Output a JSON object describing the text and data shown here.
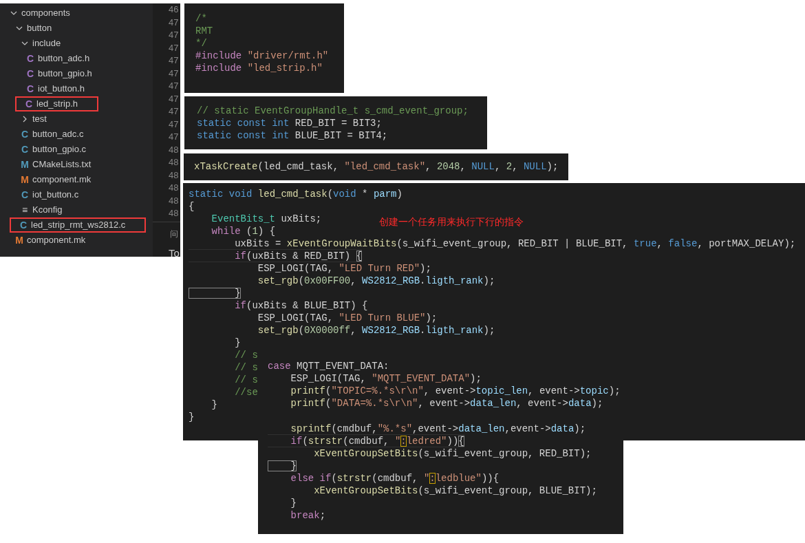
{
  "explorer": {
    "tree": [
      {
        "kind": "folder",
        "name": "components",
        "expanded": true,
        "children": [
          {
            "kind": "folder",
            "name": "button",
            "expanded": true,
            "children": [
              {
                "kind": "folder",
                "name": "include",
                "expanded": true,
                "children": [
                  {
                    "kind": "file",
                    "name": "button_adc.h",
                    "icon": "C",
                    "color": "#a074c4",
                    "highlighted": false
                  },
                  {
                    "kind": "file",
                    "name": "button_gpio.h",
                    "icon": "C",
                    "color": "#a074c4",
                    "highlighted": false
                  },
                  {
                    "kind": "file",
                    "name": "iot_button.h",
                    "icon": "C",
                    "color": "#a074c4",
                    "highlighted": false
                  },
                  {
                    "kind": "file",
                    "name": "led_strip.h",
                    "icon": "C",
                    "color": "#a074c4",
                    "highlighted": true
                  }
                ]
              },
              {
                "kind": "folder",
                "name": "test",
                "expanded": false
              },
              {
                "kind": "file",
                "name": "button_adc.c",
                "icon": "C",
                "color": "#519aba",
                "highlighted": false
              },
              {
                "kind": "file",
                "name": "button_gpio.c",
                "icon": "C",
                "color": "#519aba",
                "highlighted": false
              },
              {
                "kind": "file",
                "name": "CMakeLists.txt",
                "icon": "M",
                "color": "#519aba",
                "highlighted": false
              },
              {
                "kind": "file",
                "name": "component.mk",
                "icon": "M",
                "color": "#e37933",
                "highlighted": false
              },
              {
                "kind": "file",
                "name": "iot_button.c",
                "icon": "C",
                "color": "#519aba",
                "highlighted": false
              },
              {
                "kind": "file",
                "name": "Kconfig",
                "icon": "≡",
                "color": "#cccccc",
                "highlighted": false
              },
              {
                "kind": "file",
                "name": "led_strip_rmt_ws2812.c",
                "icon": "C",
                "color": "#519aba",
                "highlighted": true
              }
            ]
          },
          {
            "kind": "file",
            "name": "component.mk",
            "icon": "M",
            "color": "#e37933",
            "highlighted": false
          }
        ]
      }
    ],
    "line_numbers": [
      "46",
      "47",
      "47",
      "47",
      "47",
      "47",
      "47",
      "47",
      "47",
      "47",
      "47",
      "48",
      "48",
      "48",
      "48",
      "48",
      "48"
    ],
    "panel_tab": "问",
    "panel_text": "To"
  },
  "snippets": [
    {
      "lines": [
        {
          "tokens": [
            {
              "text": "/*",
              "kind": "comment"
            }
          ]
        },
        {
          "tokens": [
            {
              "text": "RMT",
              "kind": "comment"
            }
          ]
        },
        {
          "tokens": [
            {
              "text": "*/",
              "kind": "comment"
            }
          ]
        },
        {
          "tokens": [
            {
              "text": "#include ",
              "kind": "directive"
            },
            {
              "text": "\"driver/rmt.h\"",
              "kind": "string"
            }
          ]
        },
        {
          "tokens": [
            {
              "text": "#include ",
              "kind": "directive"
            },
            {
              "text": "\"led_strip.h\"",
              "kind": "string"
            }
          ]
        }
      ]
    },
    {
      "lines": [
        {
          "tokens": [
            {
              "text": "// static EventGroupHandle_t s_cmd_event_group;",
              "kind": "comment"
            }
          ]
        },
        {
          "tokens": [
            {
              "text": "static const int ",
              "kind": "type"
            },
            {
              "text": "RED_BIT = BIT3;",
              "kind": "plain"
            }
          ]
        },
        {
          "tokens": [
            {
              "text": "static const int ",
              "kind": "type"
            },
            {
              "text": "BLUE_BIT = BIT4;",
              "kind": "plain"
            }
          ]
        }
      ]
    },
    {
      "lines": [
        {
          "tokens": [
            {
              "text": "xTaskCreate",
              "kind": "function"
            },
            {
              "text": "(led_cmd_task, ",
              "kind": "plain"
            },
            {
              "text": "\"led_cmd_task\"",
              "kind": "string"
            },
            {
              "text": ", ",
              "kind": "plain"
            },
            {
              "text": "2048",
              "kind": "number"
            },
            {
              "text": ", ",
              "kind": "plain"
            },
            {
              "text": "NULL",
              "kind": "type"
            },
            {
              "text": ", ",
              "kind": "plain"
            },
            {
              "text": "2",
              "kind": "number"
            },
            {
              "text": ", ",
              "kind": "plain"
            },
            {
              "text": "NULL",
              "kind": "type"
            },
            {
              "text": ");",
              "kind": "plain"
            }
          ]
        }
      ]
    },
    {
      "lines": [
        {
          "tokens": [
            {
              "text": "static void ",
              "kind": "type"
            },
            {
              "text": "led_cmd_task",
              "kind": "function"
            },
            {
              "text": "(",
              "kind": "plain"
            },
            {
              "text": "void",
              "kind": "type"
            },
            {
              "text": " * ",
              "kind": "plain"
            },
            {
              "text": "parm",
              "kind": "variable"
            },
            {
              "text": ")",
              "kind": "plain"
            }
          ]
        },
        {
          "tokens": [
            {
              "text": "{",
              "kind": "plain"
            }
          ]
        },
        {
          "tokens": [
            {
              "text": "    EventBits_t",
              "kind": "typename"
            },
            {
              "text": " uxBits;",
              "kind": "plain"
            }
          ]
        },
        {
          "tokens": [
            {
              "text": "    while",
              "kind": "keyword"
            },
            {
              "text": " (",
              "kind": "plain"
            },
            {
              "text": "1",
              "kind": "number"
            },
            {
              "text": ") {",
              "kind": "plain"
            }
          ]
        },
        {
          "tokens": [
            {
              "text": "        uxBits = ",
              "kind": "plain"
            },
            {
              "text": "xEventGroupWaitBits",
              "kind": "function"
            },
            {
              "text": "(s_wifi_event_group, RED_BIT | BLUE_BIT, ",
              "kind": "plain"
            },
            {
              "text": "true",
              "kind": "type"
            },
            {
              "text": ", ",
              "kind": "plain"
            },
            {
              "text": "false",
              "kind": "type"
            },
            {
              "text": ", portMAX_DELAY);",
              "kind": "plain"
            }
          ]
        },
        {
          "current": true,
          "tokens": [
            {
              "text": "        if",
              "kind": "keyword"
            },
            {
              "text": "(uxBits & RED_BIT) ",
              "kind": "plain"
            },
            {
              "text": "{",
              "kind": "bracket_match"
            }
          ]
        },
        {
          "tokens": [
            {
              "text": "            ESP_LOGI(TAG, ",
              "kind": "plain"
            },
            {
              "text": "\"LED Turn RED\"",
              "kind": "string"
            },
            {
              "text": ");",
              "kind": "plain"
            }
          ]
        },
        {
          "tokens": [
            {
              "text": "            set_rgb",
              "kind": "function"
            },
            {
              "text": "(",
              "kind": "plain"
            },
            {
              "text": "0x00FF00",
              "kind": "number"
            },
            {
              "text": ", ",
              "kind": "plain"
            },
            {
              "text": "WS2812_RGB",
              "kind": "variable"
            },
            {
              "text": ".",
              "kind": "plain"
            },
            {
              "text": "ligth_rank",
              "kind": "variable"
            },
            {
              "text": ");",
              "kind": "plain"
            }
          ]
        },
        {
          "tokens": [
            {
              "text": "        }",
              "kind": "bracket_match"
            }
          ]
        },
        {
          "tokens": [
            {
              "text": "        if",
              "kind": "keyword"
            },
            {
              "text": "(uxBits & BLUE_BIT) {",
              "kind": "plain"
            }
          ]
        },
        {
          "tokens": [
            {
              "text": "            ESP_LOGI(TAG, ",
              "kind": "plain"
            },
            {
              "text": "\"LED Turn BLUE\"",
              "kind": "string"
            },
            {
              "text": ");",
              "kind": "plain"
            }
          ]
        },
        {
          "tokens": [
            {
              "text": "            set_rgb",
              "kind": "function"
            },
            {
              "text": "(",
              "kind": "plain"
            },
            {
              "text": "0X0000ff",
              "kind": "number"
            },
            {
              "text": ", ",
              "kind": "plain"
            },
            {
              "text": "WS2812_RGB",
              "kind": "variable"
            },
            {
              "text": ".",
              "kind": "plain"
            },
            {
              "text": "ligth_rank",
              "kind": "variable"
            },
            {
              "text": ");",
              "kind": "plain"
            }
          ]
        },
        {
          "tokens": [
            {
              "text": "        }",
              "kind": "plain"
            }
          ]
        },
        {
          "tokens": [
            {
              "text": "        // s",
              "kind": "comment"
            }
          ]
        },
        {
          "tokens": [
            {
              "text": "        // s",
              "kind": "comment"
            }
          ]
        },
        {
          "tokens": [
            {
              "text": "        // s",
              "kind": "comment"
            }
          ]
        },
        {
          "tokens": [
            {
              "text": "        //se",
              "kind": "comment"
            }
          ]
        },
        {
          "tokens": [
            {
              "text": "    }",
              "kind": "plain"
            }
          ]
        },
        {
          "tokens": [
            {
              "text": "}",
              "kind": "plain"
            }
          ]
        }
      ]
    },
    {
      "lines": [
        {
          "tokens": [
            {
              "text": "case",
              "kind": "keyword"
            },
            {
              "text": " MQTT_EVENT_DATA:",
              "kind": "plain"
            }
          ]
        },
        {
          "tokens": [
            {
              "text": "    ESP_LOGI(TAG, ",
              "kind": "plain"
            },
            {
              "text": "\"MQTT_EVENT_DATA\"",
              "kind": "string"
            },
            {
              "text": ");",
              "kind": "plain"
            }
          ]
        },
        {
          "tokens": [
            {
              "text": "    printf",
              "kind": "function"
            },
            {
              "text": "(",
              "kind": "plain"
            },
            {
              "text": "\"TOPIC=%.*s\\r\\n\"",
              "kind": "string"
            },
            {
              "text": ", event->",
              "kind": "plain"
            },
            {
              "text": "topic_len",
              "kind": "variable"
            },
            {
              "text": ", event->",
              "kind": "plain"
            },
            {
              "text": "topic",
              "kind": "variable"
            },
            {
              "text": ");",
              "kind": "plain"
            }
          ]
        },
        {
          "tokens": [
            {
              "text": "    printf",
              "kind": "function"
            },
            {
              "text": "(",
              "kind": "plain"
            },
            {
              "text": "\"DATA=%.*s\\r\\n\"",
              "kind": "string"
            },
            {
              "text": ", event->",
              "kind": "plain"
            },
            {
              "text": "data_len",
              "kind": "variable"
            },
            {
              "text": ", event->",
              "kind": "plain"
            },
            {
              "text": "data",
              "kind": "variable"
            },
            {
              "text": ");",
              "kind": "plain"
            }
          ]
        },
        {
          "blank_before": true,
          "tokens": [
            {
              "text": "    sprintf",
              "kind": "function"
            },
            {
              "text": "(cmdbuf,",
              "kind": "plain"
            },
            {
              "text": "\"%.*s\"",
              "kind": "string"
            },
            {
              "text": ",event->",
              "kind": "plain"
            },
            {
              "text": "data_len",
              "kind": "variable"
            },
            {
              "text": ",event->",
              "kind": "plain"
            },
            {
              "text": "data",
              "kind": "variable"
            },
            {
              "text": ");",
              "kind": "plain"
            }
          ]
        },
        {
          "current": true,
          "tokens": [
            {
              "text": "    if",
              "kind": "keyword"
            },
            {
              "text": "(",
              "kind": "plain"
            },
            {
              "text": "strstr",
              "kind": "function"
            },
            {
              "text": "(cmdbuf, ",
              "kind": "plain"
            },
            {
              "text": "\"",
              "kind": "string"
            },
            {
              "text": ":",
              "kind": "find_match"
            },
            {
              "text": "ledred\"",
              "kind": "string"
            },
            {
              "text": "))",
              "kind": "plain"
            },
            {
              "text": "{",
              "kind": "bracket_match"
            }
          ]
        },
        {
          "tokens": [
            {
              "text": "        xEventGroupSetBits",
              "kind": "function"
            },
            {
              "text": "(s_wifi_event_group, RED_BIT);",
              "kind": "plain"
            }
          ]
        },
        {
          "tokens": [
            {
              "text": "    }",
              "kind": "bracket_match"
            }
          ]
        },
        {
          "tokens": [
            {
              "text": "    else if",
              "kind": "keyword"
            },
            {
              "text": "(",
              "kind": "plain"
            },
            {
              "text": "strstr",
              "kind": "function"
            },
            {
              "text": "(cmdbuf, ",
              "kind": "plain"
            },
            {
              "text": "\"",
              "kind": "string"
            },
            {
              "text": ":",
              "kind": "find_match"
            },
            {
              "text": "ledblue\"",
              "kind": "string"
            },
            {
              "text": ")){",
              "kind": "plain"
            }
          ]
        },
        {
          "tokens": [
            {
              "text": "        xEventGroupSetBits",
              "kind": "function"
            },
            {
              "text": "(s_wifi_event_group, BLUE_BIT);",
              "kind": "plain"
            }
          ]
        },
        {
          "tokens": [
            {
              "text": "    }",
              "kind": "plain"
            }
          ]
        },
        {
          "tokens": [
            {
              "text": "    break",
              "kind": "keyword"
            },
            {
              "text": ";",
              "kind": "plain"
            }
          ]
        }
      ]
    }
  ],
  "annotation": "创建一个任务用来执行下行的指令"
}
